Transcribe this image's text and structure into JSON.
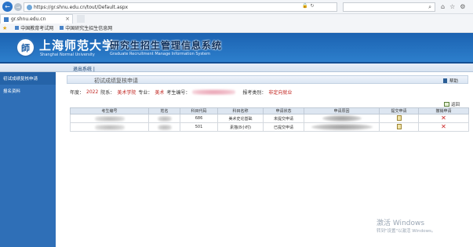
{
  "browser": {
    "url": "https://gr.shnu.edu.cn/tout/Default.aspx",
    "tab_title": "gr.shnu.edu.cn",
    "favorites": [
      "中国教育考试网",
      "中国研究生招生信息网"
    ]
  },
  "header": {
    "university_cn": "上海师范大学",
    "university_en": "Shanghai Normal University",
    "system_title": "研究生招生管理信息系统",
    "system_subtitle": "Graduate Recruitment Manage Information System"
  },
  "subbar": {
    "exit_label": "退出系统"
  },
  "sidebar": {
    "items": [
      {
        "label": "初试成绩复核申请",
        "active": true
      },
      {
        "label": "报名资料",
        "active": false
      }
    ]
  },
  "panel": {
    "title": "初试成绩复核申请",
    "help_label": "帮助",
    "info": {
      "year_label": "年度：",
      "year": "2022",
      "dept_label": "院系：",
      "dept": "美术学院",
      "major_label": "专业：",
      "major": "美术",
      "exam_no_label": "考生编号：",
      "category_label": "报考类别：",
      "category": "非定向就业"
    },
    "return_label": "返回"
  },
  "table": {
    "columns": [
      "考生编号",
      "姓名",
      "科目代码",
      "科目名称",
      "申请状态",
      "申请原因",
      "提交申请",
      "撤销申请"
    ],
    "rows": [
      {
        "code": "686",
        "subject": "美术史论基础",
        "status": "未提交申请"
      },
      {
        "code": "501",
        "subject": "素描(8小时)",
        "status": "已提交申请"
      }
    ]
  },
  "watermark": {
    "title": "激活 Windows",
    "subtitle": "转到\"设置\"以激活 Windows。"
  }
}
